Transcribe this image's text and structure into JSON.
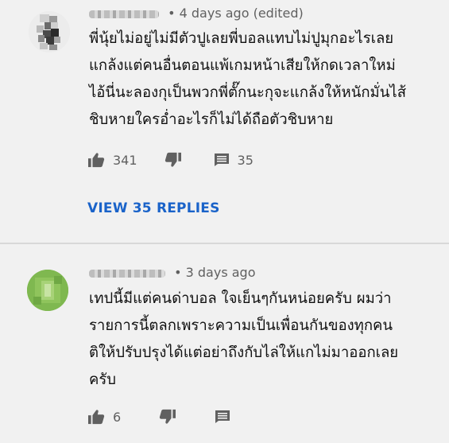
{
  "comments": [
    {
      "timestamp": "• 4 days ago (edited)",
      "text_lines": [
        "พี่นุ้ยไม่อยู่ไม่มีตัวปูเลยพี่บอลแทบไม่ปูมุกอะไรเลย",
        "แกล้งแต่คนอื่นตอนแพ้เกมหน้าเสียให้กดเวลาใหม่",
        "ไอ้นี่นะลองกุเป็นพวกพี่ตั๊กนะกุจะแกล้งให้หนักมั่นไส้",
        "ชิบหายใครอ่ำอะไรก็ไม่ได้ถือตัวชิบหาย"
      ],
      "likes": "341",
      "replies_count": "35",
      "view_replies_label": "VIEW 35 REPLIES"
    },
    {
      "timestamp": "• 3 days ago",
      "text_lines": [
        "เทปนี้มีแต่คนด่าบอล ใจเย็นๆกันหน่อยครับ ผมว่า",
        "รายการนี้ตลกเพราะความเป็นเพื่อนกันของทุกคน",
        "ติให้ปรับปรุงได้แต่อย่าถึงกับไล่ให้แกไม่มาออกเลย",
        "ครับ"
      ],
      "likes": "6"
    }
  ],
  "icons": {
    "like": "thumbs-up-icon",
    "dislike": "thumbs-down-icon",
    "reply": "comment-icon"
  },
  "colors": {
    "background": "#f1f1f1",
    "link": "#1a63c9",
    "meta": "#606060",
    "avatar_green": "#7fb850"
  }
}
